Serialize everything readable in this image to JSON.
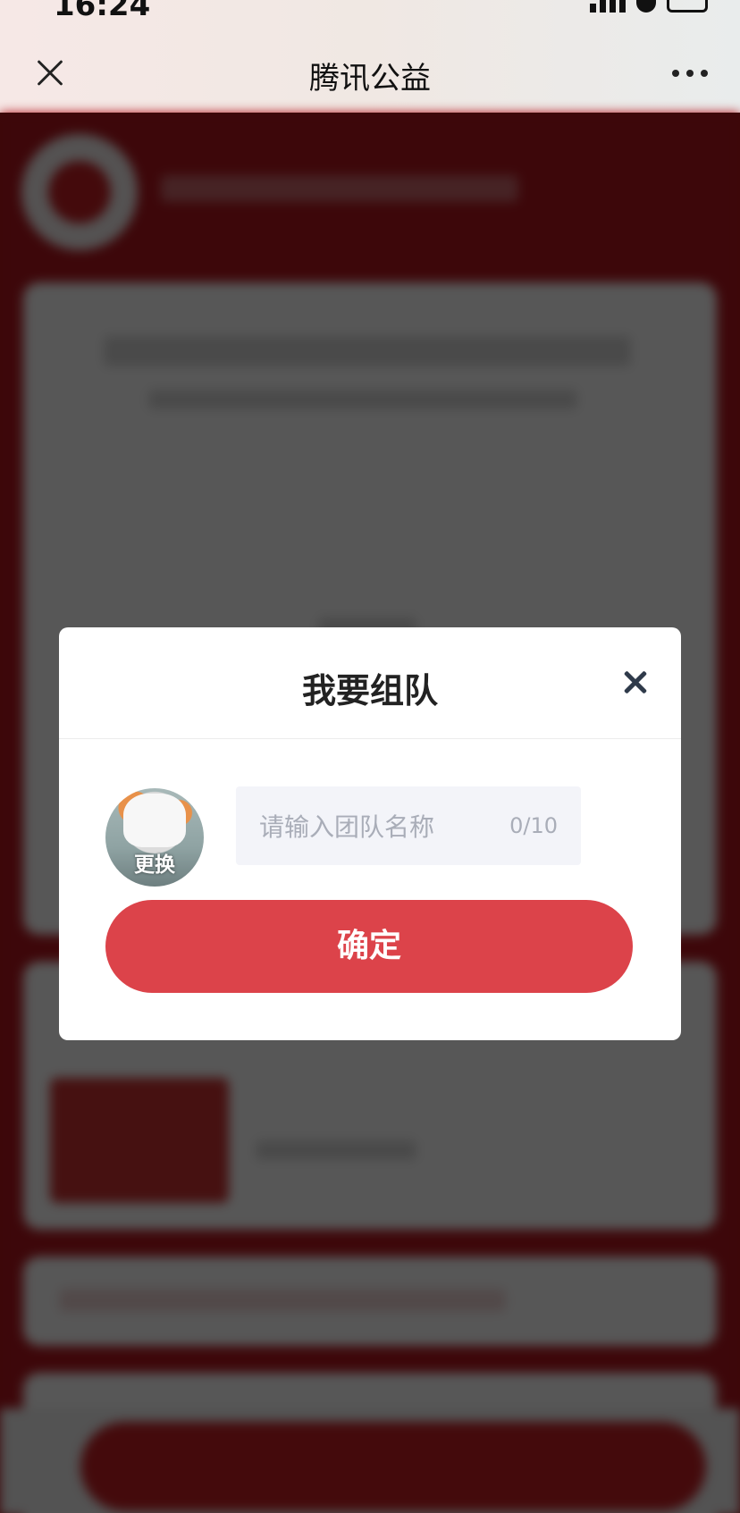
{
  "status_bar": {
    "time": "16:24"
  },
  "nav": {
    "title": "腾讯公益"
  },
  "modal": {
    "title": "我要组队",
    "avatar_label": "更换",
    "name_placeholder": "请输入团队名称",
    "char_count": "0/10",
    "confirm_label": "确定"
  },
  "colors": {
    "accent": "#dc434a",
    "background_red": "#b3161e",
    "title_text": "#222222",
    "placeholder": "#a9adb8"
  }
}
